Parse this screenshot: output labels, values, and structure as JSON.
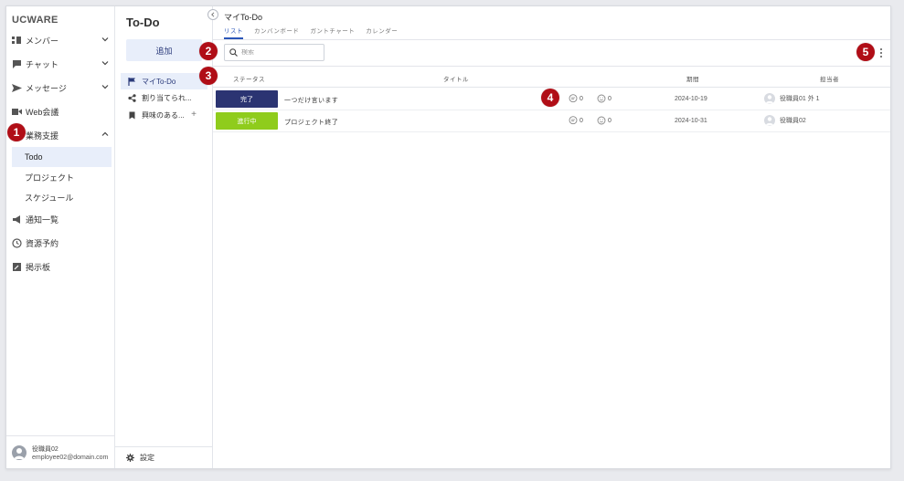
{
  "app": {
    "brand": "UCWARE"
  },
  "sidebar": {
    "items": [
      {
        "label": "メンバー",
        "icon": "members-icon",
        "expandable": true
      },
      {
        "label": "チャット",
        "icon": "chat-icon",
        "expandable": true
      },
      {
        "label": "メッセージ",
        "icon": "send-icon",
        "expandable": true
      },
      {
        "label": "Web会議",
        "icon": "video-icon",
        "expandable": false
      },
      {
        "label": "業務支援",
        "icon": "briefcase-icon",
        "expandable": true,
        "expanded": true
      }
    ],
    "sub_items": [
      {
        "label": "Todo",
        "active": true
      },
      {
        "label": "プロジェクト",
        "active": false
      },
      {
        "label": "スケジュール",
        "active": false
      }
    ],
    "bottom_items": [
      {
        "label": "通知一覧",
        "icon": "megaphone-icon"
      },
      {
        "label": "資源予約",
        "icon": "clock-icon"
      },
      {
        "label": "掲示板",
        "icon": "board-icon"
      }
    ],
    "user": {
      "name": "役職員02",
      "email": "employee02@domain.com"
    }
  },
  "todo_panel": {
    "title": "To-Do",
    "add_label": "追加",
    "lists": [
      {
        "label": "マイTo-Do",
        "icon": "flag-icon",
        "active": true
      },
      {
        "label": "割り当てられ...",
        "icon": "share-icon",
        "active": false
      },
      {
        "label": "興味のある...",
        "icon": "bookmark-icon",
        "active": false,
        "add": "+"
      }
    ],
    "settings_label": "設定"
  },
  "main": {
    "title": "マイTo-Do",
    "tabs": [
      {
        "label": "リスト",
        "active": true
      },
      {
        "label": "カンバンボード",
        "active": false
      },
      {
        "label": "ガントチャート",
        "active": false
      },
      {
        "label": "カレンダー",
        "active": false
      }
    ],
    "search": {
      "placeholder": "検索",
      "value": ""
    },
    "columns": {
      "status": "ステータス",
      "title": "タイトル",
      "period": "期間",
      "assignee": "担当者"
    },
    "rows": [
      {
        "status": "完了",
        "status_color": "#2b3472",
        "title": "一つだけ言います",
        "comments": "0",
        "reactions": "0",
        "date": "2024-10-19",
        "assignee": "役職員01 外 1"
      },
      {
        "status": "進行中",
        "status_color": "#8fcc1c",
        "title": "プロジェクト終了",
        "comments": "0",
        "reactions": "0",
        "date": "2024-10-31",
        "assignee": "役職員02"
      }
    ]
  },
  "callouts": [
    "1",
    "2",
    "3",
    "4",
    "5"
  ],
  "colors": {
    "accent": "#2a55b8",
    "callout": "#b00e17",
    "active_bg": "#e8eefa"
  }
}
